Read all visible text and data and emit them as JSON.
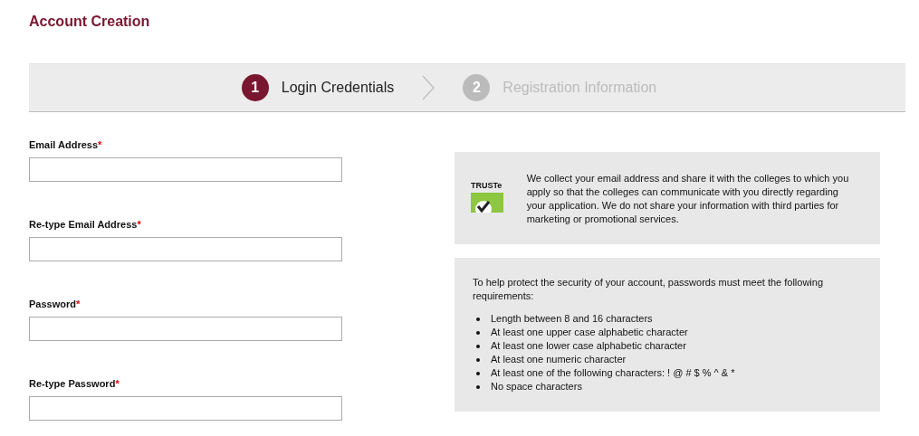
{
  "page_title": "Account Creation",
  "steps": [
    {
      "number": "1",
      "label": "Login Credentials",
      "selected": true
    },
    {
      "number": "2",
      "label": "Registration Information",
      "selected": false
    }
  ],
  "fields": [
    {
      "label": "Email Address",
      "required_mark": "*"
    },
    {
      "label": "Re-type Email Address",
      "required_mark": "*"
    },
    {
      "label": "Password",
      "required_mark": "*"
    },
    {
      "label": "Re-type Password",
      "required_mark": "*"
    }
  ],
  "privacy_notice": {
    "badge": "TRUSTe",
    "text": "We collect your email address and share it with the colleges to which you apply so that the colleges can communicate with you directly regarding your application. We do not share your information with third parties for marketing or promotional services."
  },
  "password_rules": {
    "intro": "To help protect the security of your account, passwords must meet the following requirements:",
    "items": [
      "Length between 8 and 16 characters",
      "At least one upper case alphabetic character",
      "At least one lower case alphabetic character",
      "At least one numeric character",
      "At least one of the following characters: ! @ # $ % ^ & *",
      "No space characters"
    ]
  }
}
